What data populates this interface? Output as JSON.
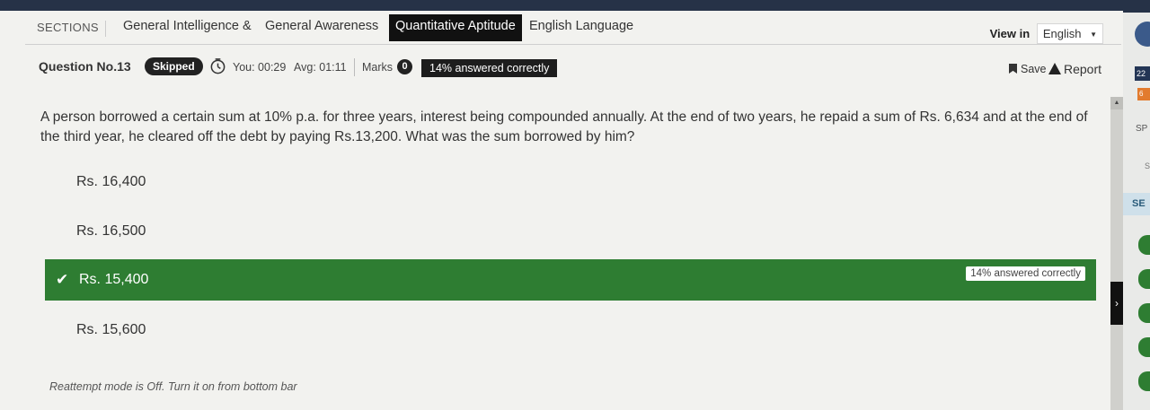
{
  "sections": {
    "label": "SECTIONS",
    "tabs": [
      {
        "label": "General Intelligence &"
      },
      {
        "label": "General Awareness"
      },
      {
        "label": "Quantitative Aptitude"
      },
      {
        "label": "English Language"
      }
    ],
    "active_index": 2
  },
  "view_in": {
    "label": "View in",
    "selected": "English"
  },
  "question_info": {
    "number_label": "Question No.13",
    "status": "Skipped",
    "you_time": "You: 00:29",
    "avg_time": "Avg: 01:11",
    "marks_label": "Marks",
    "marks_value": "0",
    "answered_correctly": "14% answered correctly",
    "save_label": "Save",
    "report_label": "Report"
  },
  "question": {
    "text": "A person borrowed a certain sum at 10% p.a. for three years, interest being compounded annually. At the end of two years, he repaid a sum of Rs. 6,634 and at the end of the third year, he cleared off the debt by paying Rs.13,200. What was the sum borrowed by him?"
  },
  "options": [
    {
      "label": "Rs. 16,400"
    },
    {
      "label": "Rs. 16,500"
    },
    {
      "label": "Rs. 15,400",
      "correct_badge": "14% answered correctly"
    },
    {
      "label": "Rs. 15,600"
    }
  ],
  "footer": {
    "reattempt_note": "Reattempt mode is Off. Turn it on from bottom bar"
  },
  "side_panel": {
    "time_fragment": "22",
    "orange_fragment": "6",
    "sp_fragment": "SP",
    "s_fragment": "S",
    "se_fragment": "SE"
  },
  "colors": {
    "correct_option": "#2e7d32",
    "active_tab": "#111111",
    "badge_dark": "#1d1d1d"
  },
  "icons": {
    "timer": "stopwatch-icon",
    "save": "bookmark-icon",
    "report": "warning-icon",
    "correct": "checkmark-icon",
    "dropdown": "caret-down-icon",
    "toggle": "chevron-right-icon"
  }
}
